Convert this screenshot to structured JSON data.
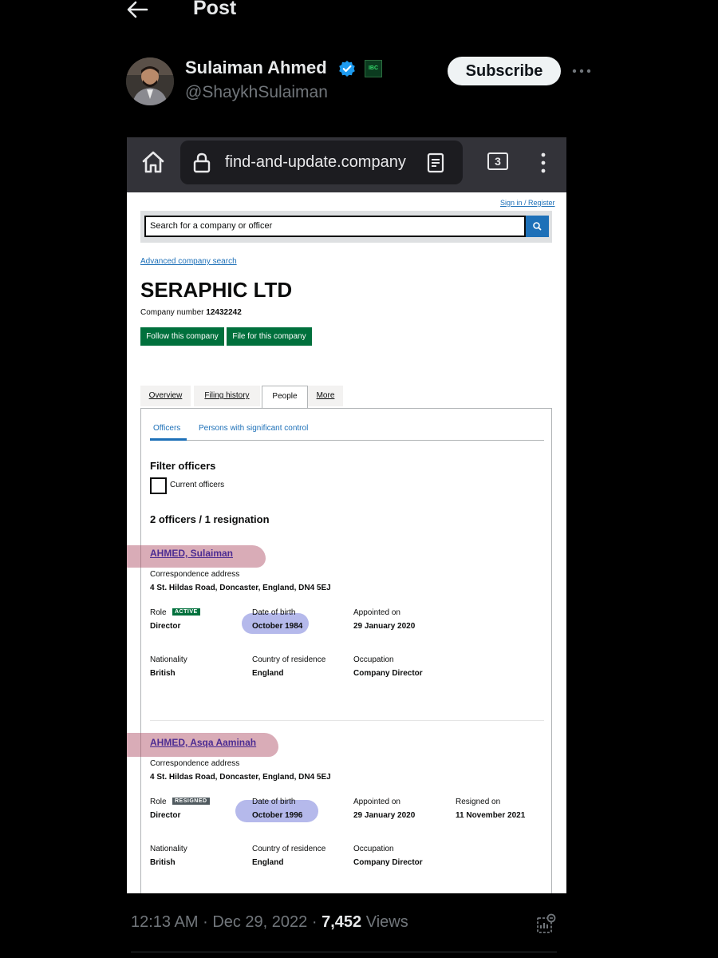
{
  "header": {
    "title": "Post"
  },
  "author": {
    "name": "Sulaiman Ahmed",
    "handle": "@ShaykhSulaiman",
    "affiliate_badge": "IBC",
    "subscribe_label": "Subscribe"
  },
  "browser": {
    "url": "find-and-update.company",
    "tab_count": "3"
  },
  "page": {
    "sign_in": "Sign in / Register",
    "search_placeholder": "Search for a company or officer",
    "advanced_search": "Advanced company search",
    "company_name": "SERAPHIC LTD",
    "company_number_label": "Company number",
    "company_number": "12432242",
    "follow_button": "Follow this company",
    "file_button": "File for this company",
    "tabs": [
      "Overview",
      "Filing history",
      "People",
      "More"
    ],
    "subtabs": [
      "Officers",
      "Persons with significant control"
    ],
    "filter_title": "Filter officers",
    "filter_option": "Current officers",
    "officers_count": "2 officers / 1 resignation",
    "labels": {
      "correspondence": "Correspondence address",
      "role": "Role",
      "dob": "Date of birth",
      "appointed": "Appointed on",
      "resigned": "Resigned on",
      "nationality": "Nationality",
      "residence": "Country of residence",
      "occupation": "Occupation"
    },
    "officers": [
      {
        "name": "AHMED, Sulaiman",
        "address": "4 St. Hildas Road, Doncaster, England, DN4 5EJ",
        "status": "ACTIVE",
        "role": "Director",
        "dob": "October 1984",
        "appointed": "29 January 2020",
        "nationality": "British",
        "residence": "England",
        "occupation": "Company Director"
      },
      {
        "name": "AHMED, Asqa Aaminah",
        "address": "4 St. Hildas Road, Doncaster, England, DN4 5EJ",
        "status": "RESIGNED",
        "role": "Director",
        "dob": "October 1996",
        "appointed": "29 January 2020",
        "resigned": "11 November 2021",
        "nationality": "British",
        "residence": "England",
        "occupation": "Company Director"
      }
    ]
  },
  "footer": {
    "time": "12:13 AM",
    "date": "Dec 29, 2022",
    "views_count": "7,452",
    "views_label": "Views"
  },
  "colors": {
    "link": "#1d70b8",
    "green": "#00703c",
    "visited": "#4c2c92",
    "highlight_pink": "#aa465f",
    "highlight_blue": "#5a64d2"
  }
}
